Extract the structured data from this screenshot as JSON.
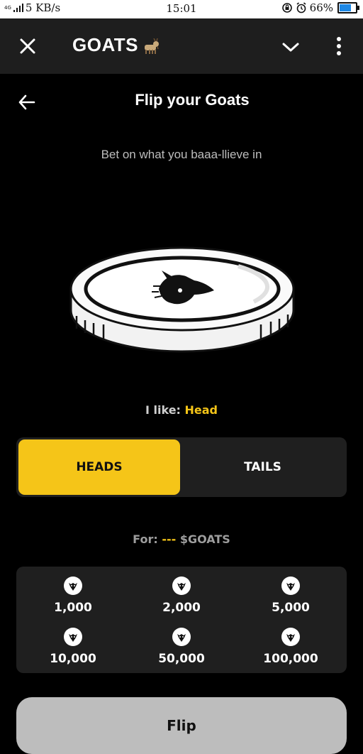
{
  "status_bar": {
    "network": "4G",
    "speed": "5 KB/s",
    "time": "15:01",
    "battery": "66%",
    "battery_level": 0.66
  },
  "app_header": {
    "title": "GOATS",
    "close_icon": "close-icon",
    "title_emoji": "goat-emoji-icon",
    "menu_icon": "chevron-down-icon",
    "more_icon": "more-vertical-icon"
  },
  "page": {
    "title": "Flip your Goats",
    "subtitle": "Bet on what you baaa-llieve in",
    "back_icon": "arrow-left-icon"
  },
  "choice": {
    "label": "I like:",
    "value": "Head"
  },
  "toggle": {
    "heads": "HEADS",
    "tails": "TAILS",
    "selected": "HEADS"
  },
  "amount": {
    "label": "For:",
    "value": "---",
    "currency": "$GOATS"
  },
  "amounts": [
    {
      "label": "1,000"
    },
    {
      "label": "2,000"
    },
    {
      "label": "5,000"
    },
    {
      "label": "10,000"
    },
    {
      "label": "50,000"
    },
    {
      "label": "100,000"
    }
  ],
  "flip_button": {
    "label": "Flip"
  },
  "colors": {
    "accent": "#f5c518",
    "background": "#000000",
    "panel": "#1f1f1f",
    "header": "#1e1e1e",
    "button_disabled": "#bdbdbd"
  }
}
